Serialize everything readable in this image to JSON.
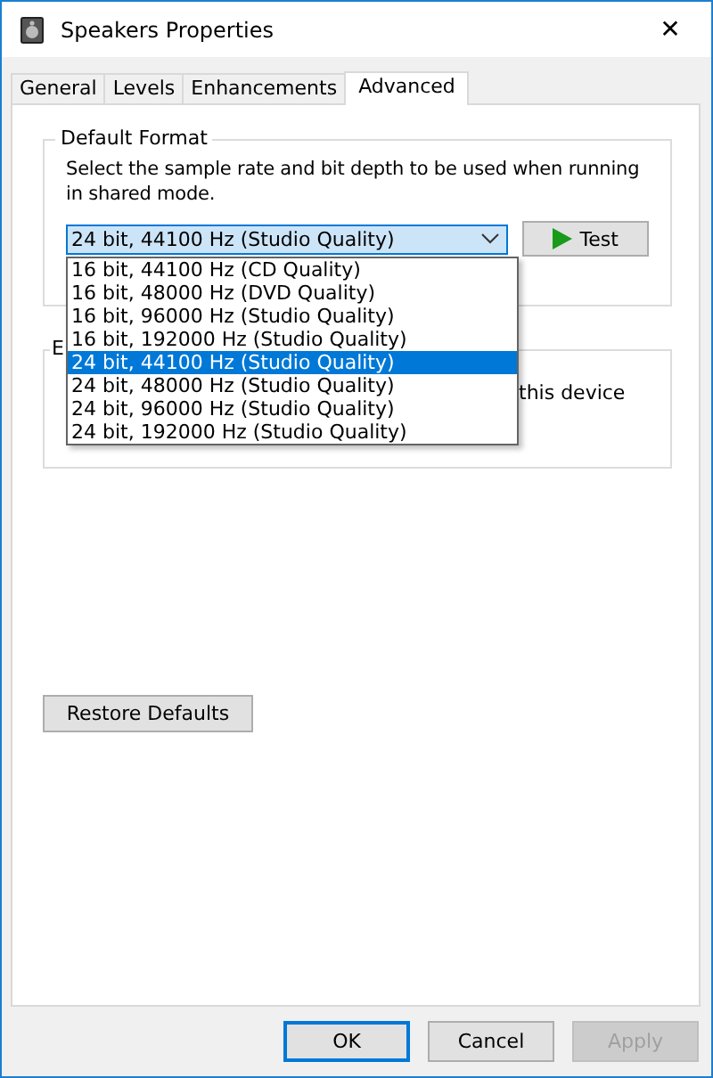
{
  "window": {
    "title": "Speakers Properties",
    "close": "✕"
  },
  "tabs": [
    {
      "label": "General",
      "selected": false
    },
    {
      "label": "Levels",
      "selected": false
    },
    {
      "label": "Enhancements",
      "selected": false
    },
    {
      "label": "Advanced",
      "selected": true
    }
  ],
  "default_format": {
    "title": "Default Format",
    "description": "Select the sample rate and bit depth to be used when running in shared mode.",
    "value": "24 bit, 44100 Hz (Studio Quality)",
    "test_button": "Test",
    "options": [
      {
        "label": "16 bit, 44100 Hz (CD Quality)",
        "selected": false
      },
      {
        "label": "16 bit, 48000 Hz (DVD Quality)",
        "selected": false
      },
      {
        "label": "16 bit, 96000 Hz (Studio Quality)",
        "selected": false
      },
      {
        "label": "16 bit, 192000 Hz (Studio Quality)",
        "selected": false
      },
      {
        "label": "24 bit, 44100 Hz (Studio Quality)",
        "selected": true
      },
      {
        "label": "24 bit, 48000 Hz (Studio Quality)",
        "selected": false
      },
      {
        "label": "24 bit, 96000 Hz (Studio Quality)",
        "selected": false
      },
      {
        "label": "24 bit, 192000 Hz (Studio Quality)",
        "selected": false
      }
    ]
  },
  "exclusive_mode": {
    "title": "E",
    "text": "this device"
  },
  "restore_button": "Restore Defaults",
  "buttons": [
    {
      "label": "OK",
      "kind": "default",
      "disabled": false
    },
    {
      "label": "Cancel",
      "kind": "normal",
      "disabled": false
    },
    {
      "label": "Apply",
      "kind": "normal",
      "disabled": true
    }
  ]
}
